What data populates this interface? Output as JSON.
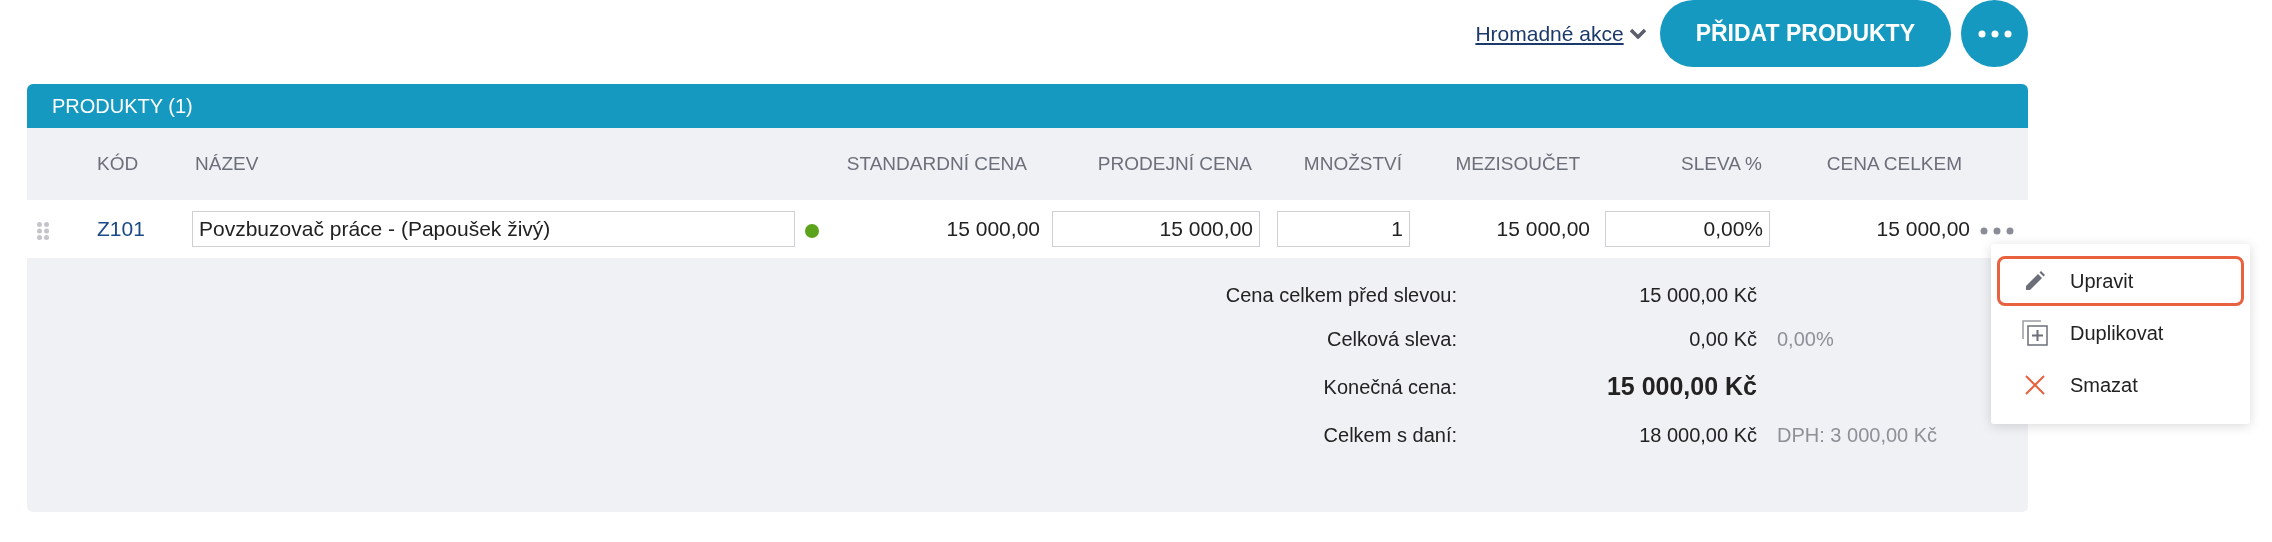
{
  "toolbar": {
    "bulk_actions": "Hromadné akce",
    "add_button": "PŘIDAT PRODUKTY"
  },
  "panel": {
    "title": "PRODUKTY (1)",
    "columns": [
      "KÓD",
      "NÁZEV",
      "STANDARDNÍ CENA",
      "PRODEJNÍ CENA",
      "MNOŽSTVÍ",
      "MEZISOUČET",
      "SLEVA %",
      "CENA CELKEM"
    ],
    "rows": [
      {
        "code": "Z101",
        "name": "Povzbuzovač práce - (Papoušek živý)",
        "color": "#5ba31b",
        "standard_price": "15 000,00",
        "sale_price": "15 000,00",
        "quantity": "1",
        "subtotal": "15 000,00",
        "discount": "0,00%",
        "total": "15 000,00"
      }
    ],
    "summary": [
      {
        "kind": "normal",
        "label": "Cena celkem před slevou:",
        "value": "15 000,00 Kč"
      },
      {
        "kind": "normal",
        "label": "Celková sleva:",
        "value": "0,00 Kč",
        "note": "0,00%"
      },
      {
        "kind": "total",
        "label": "Konečná cena:",
        "value": "15 000,00 Kč"
      },
      {
        "kind": "normal",
        "label": "Celkem s daní:",
        "value": "18 000,00 Kč",
        "note": "DPH: 3 000,00 Kč"
      }
    ]
  },
  "row_menu": [
    {
      "kind": "edit",
      "label": "Upravit",
      "selected": true
    },
    {
      "kind": "duplicate",
      "label": "Duplikovat",
      "selected": false
    },
    {
      "kind": "delete",
      "label": "Smazat",
      "selected": false
    }
  ]
}
